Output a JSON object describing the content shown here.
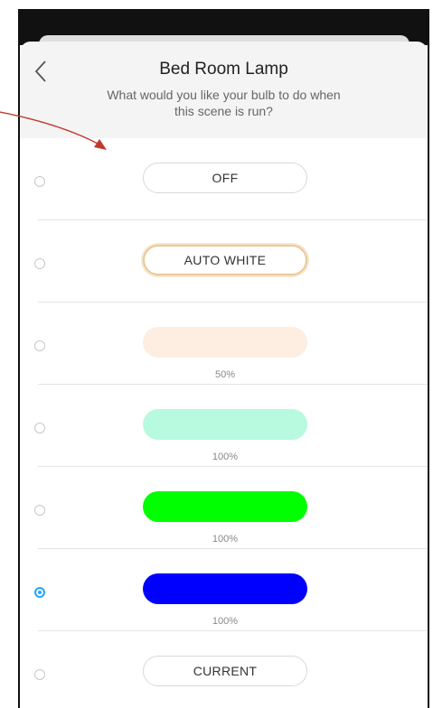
{
  "header": {
    "title": "Bed Room Lamp",
    "subtitle": "What would you like your bulb to do when this scene is run?"
  },
  "options": [
    {
      "label": "OFF",
      "percent": "",
      "color": "#ffffff",
      "selected": false
    },
    {
      "label": "AUTO WHITE",
      "percent": "",
      "color": "#ffffff",
      "selected": false
    },
    {
      "label": "",
      "percent": "50%",
      "color": "#fdeee1",
      "selected": false
    },
    {
      "label": "",
      "percent": "100%",
      "color": "#b7fadf",
      "selected": false
    },
    {
      "label": "",
      "percent": "100%",
      "color": "#00ff00",
      "selected": false
    },
    {
      "label": "",
      "percent": "100%",
      "color": "#0000ff",
      "selected": true
    },
    {
      "label": "CURRENT",
      "percent": "",
      "color": "#ffffff",
      "selected": false
    }
  ],
  "colors": {
    "accent": "#2aa6ff",
    "annotation": "#c0392b"
  },
  "icons": {
    "back": "chevron-left-icon"
  }
}
